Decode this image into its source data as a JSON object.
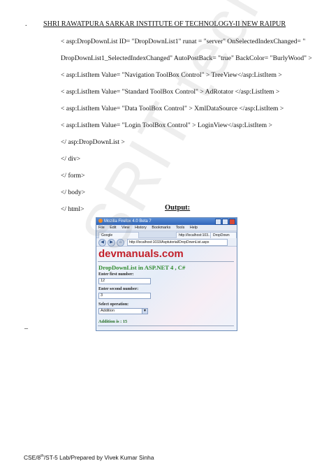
{
  "header": {
    "dot": ".",
    "title": "SHRI RAWATPURA  SARKAR INSTITUTE  OF TECHNOLOGY-II NEW RAIPUR"
  },
  "code_lines": [
    "< asp:DropDownList ID= \"DropDownList1\" runat = \"server\" OnSelectedIndexChanged= \"",
    "DropDownList1_SelectedIndexChanged\" AutoPostBack= \"true\" BackColor= \"BurlyWood\"  >",
    "< asp:ListItem Value= \"Navigation ToolBox Control\" > TreeView</asp:ListItem >",
    "< asp:ListItem Value= \"Standard ToolBox Control\" > AdRotator </asp:ListItem >",
    "< asp:ListItem Value= \"Data ToolBox  Control\" > XmlDataSource </asp:ListItem >",
    "< asp:ListItem Value= \"Login  ToolBox Control\" > LoginView</asp:ListItem >",
    "</ asp:DropDownList >",
    "</ div>",
    "</ form>",
    "</ body>",
    "</ html>"
  ],
  "output_label": "Output:",
  "browser": {
    "window_title": "Mozilla Firefox 4.0 Beta 7",
    "menu": [
      "File",
      "Edit",
      "View",
      "History",
      "Bookmarks",
      "Tools",
      "Help"
    ],
    "tabs": [
      "Google",
      "http://localhost:103...",
      "DropDown"
    ],
    "url": "http://localhost:1033/Asptutorial/DropDownList.aspx",
    "nav_buttons": [
      "◀",
      "▶",
      "⌂"
    ],
    "site_logo": "devmanuals.com",
    "heading": "DropDownList in ASP.NET 4 , C#",
    "first_label": "Enter first number:",
    "first_value": "12",
    "second_label": "Enter second number:",
    "second_value": "3",
    "operation_label": "Select operation:",
    "operation_value": "Addition",
    "result": "Addition is : 15"
  },
  "watermark": "SRIT tech-II",
  "stray_mark": "_",
  "footer": {
    "prefix": "CSE/8",
    "sup": "th",
    "suffix": "/ST-5 Lab/Prepared by Vivek Kumar Sinha"
  }
}
